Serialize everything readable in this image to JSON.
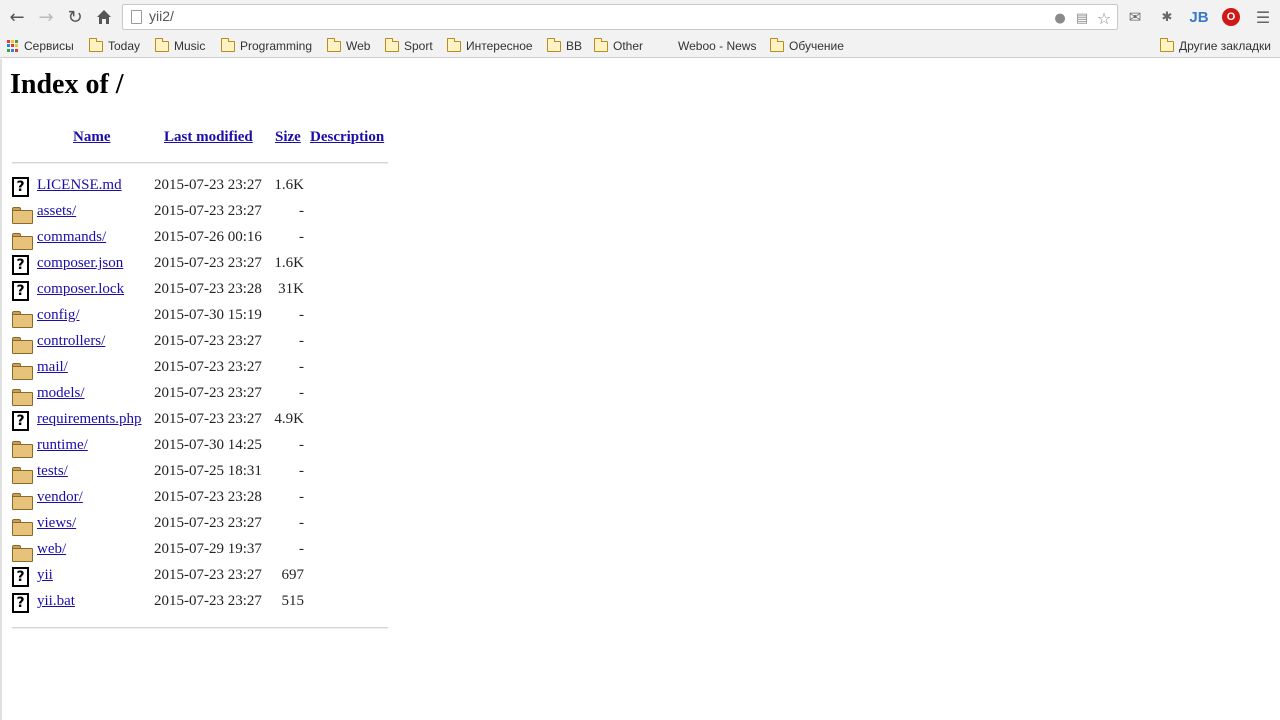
{
  "browser": {
    "url": "yii2/",
    "extensions": {
      "jb_label": "JB",
      "opera_label": "O"
    },
    "bookmarks": [
      {
        "label": "Сервисы",
        "icon": "apps-grid-icon"
      },
      {
        "label": "Today",
        "icon": "folder-icon"
      },
      {
        "label": "Music",
        "icon": "folder-icon"
      },
      {
        "label": "Programming",
        "icon": "folder-icon"
      },
      {
        "label": "Web",
        "icon": "folder-icon"
      },
      {
        "label": "Sport",
        "icon": "folder-icon"
      },
      {
        "label": "Интересное",
        "icon": "folder-icon"
      },
      {
        "label": "BB",
        "icon": "folder-icon"
      },
      {
        "label": "Other",
        "icon": "folder-icon"
      },
      {
        "label": "Weboo - News",
        "icon": "none"
      },
      {
        "label": "Обучение",
        "icon": "folder-icon"
      }
    ],
    "other_bookmarks": "Другие закладки"
  },
  "page": {
    "title": "Index of /",
    "columns": {
      "name": "Name",
      "last_modified": "Last modified",
      "size": "Size",
      "description": "Description"
    },
    "entries": [
      {
        "type": "file",
        "name": "LICENSE.md",
        "date": "2015-07-23 23:27",
        "size": "1.6K"
      },
      {
        "type": "dir",
        "name": "assets/",
        "date": "2015-07-23 23:27",
        "size": "-"
      },
      {
        "type": "dir",
        "name": "commands/",
        "date": "2015-07-26 00:16",
        "size": "-"
      },
      {
        "type": "file",
        "name": "composer.json",
        "date": "2015-07-23 23:27",
        "size": "1.6K"
      },
      {
        "type": "file",
        "name": "composer.lock",
        "date": "2015-07-23 23:28",
        "size": "31K"
      },
      {
        "type": "dir",
        "name": "config/",
        "date": "2015-07-30 15:19",
        "size": "-"
      },
      {
        "type": "dir",
        "name": "controllers/",
        "date": "2015-07-23 23:27",
        "size": "-"
      },
      {
        "type": "dir",
        "name": "mail/",
        "date": "2015-07-23 23:27",
        "size": "-"
      },
      {
        "type": "dir",
        "name": "models/",
        "date": "2015-07-23 23:27",
        "size": "-"
      },
      {
        "type": "file",
        "name": "requirements.php",
        "date": "2015-07-23 23:27",
        "size": "4.9K"
      },
      {
        "type": "dir",
        "name": "runtime/",
        "date": "2015-07-30 14:25",
        "size": "-"
      },
      {
        "type": "dir",
        "name": "tests/",
        "date": "2015-07-25 18:31",
        "size": "-"
      },
      {
        "type": "dir",
        "name": "vendor/",
        "date": "2015-07-23 23:28",
        "size": "-"
      },
      {
        "type": "dir",
        "name": "views/",
        "date": "2015-07-23 23:27",
        "size": "-"
      },
      {
        "type": "dir",
        "name": "web/",
        "date": "2015-07-29 19:37",
        "size": "-"
      },
      {
        "type": "file",
        "name": "yii",
        "date": "2015-07-23 23:27",
        "size": "697"
      },
      {
        "type": "file",
        "name": "yii.bat",
        "date": "2015-07-23 23:27",
        "size": "515"
      }
    ]
  }
}
